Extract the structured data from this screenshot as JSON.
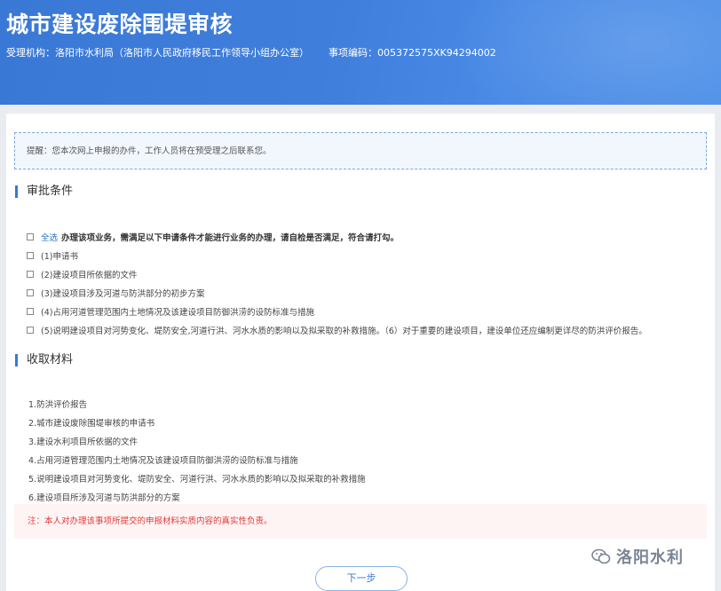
{
  "header": {
    "title": "城市建设废除围堤审核",
    "agency": "受理机构：洛阳市水利局（洛阳市人民政府移民工作领导小组办公室）",
    "item_code": "事项编码：005372575XK94294002"
  },
  "notice": "提醒：您本次网上申报的办件，工作人员将在预受理之后联系您。",
  "conditions": {
    "title": "审批条件",
    "select_all": "全选",
    "lead": "办理该项业务，需满足以下申请条件才能进行业务的办理，请自检是否满足，符合请打勾。",
    "items": [
      "(1)申请书",
      "(2)建设项目所依据的文件",
      "(3)建设项目涉及河道与防洪部分的初步方案",
      "(4)占用河道管理范围内土地情况及该建设项目防御洪涝的设防标准与措施",
      "(5)说明建设项目对河势变化、堤防安全,河道行洪、河水水质的影响以及拟采取的补救措施。（6）对于重要的建设项目，建设单位还应编制更详尽的防洪评价报告。"
    ]
  },
  "materials": {
    "title": "收取材料",
    "items": [
      "1.防洪评价报告",
      "2.城市建设废除围堤审核的申请书",
      "3.建设水利项目所依据的文件",
      "4.占用河道管理范围内土地情况及该建设项目防御洪涝的设防标准与措施",
      "5.说明建设项目对河势变化、堤防安全、河道行洪、河水水质的影响以及拟采取的补救措施",
      "6.建设项目所涉及河道与防洪部分的方案"
    ]
  },
  "warning": "注：本人对办理该事项所提交的申报材料实质内容的真实性负责。",
  "next_label": "下一步",
  "watermark": "洛阳水利"
}
